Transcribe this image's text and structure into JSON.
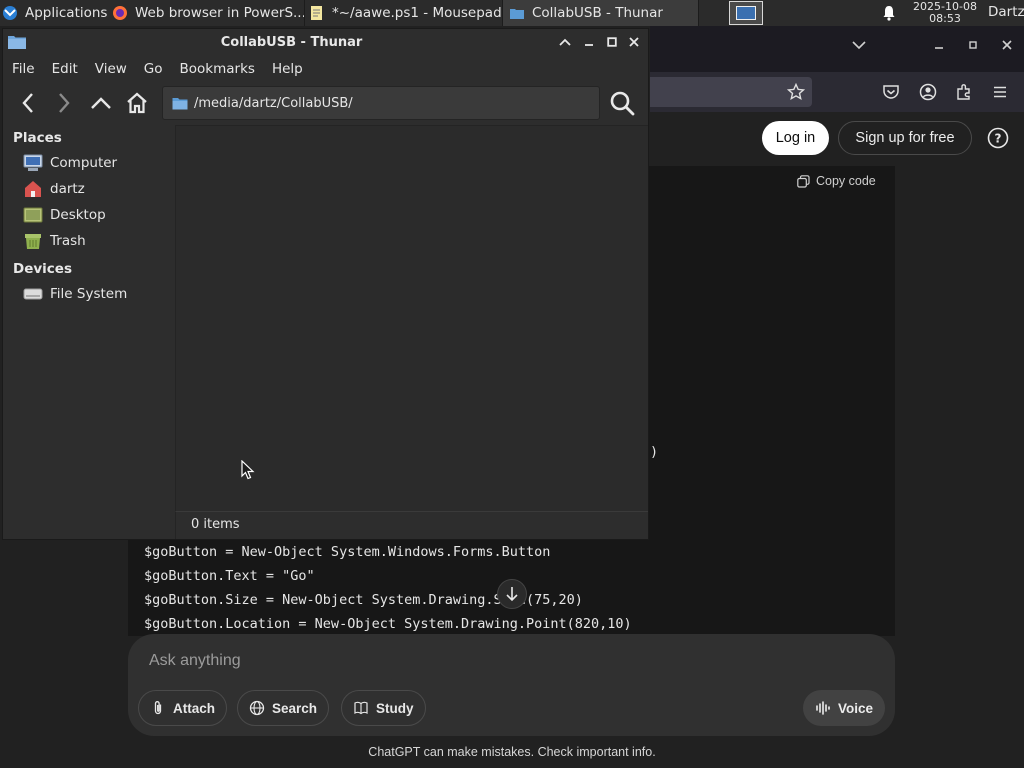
{
  "panel": {
    "applications_label": "Applications",
    "tasks": [
      {
        "label": "Web browser in PowerS..."
      },
      {
        "label": "*~/aawe.ps1 - Mousepad"
      },
      {
        "label": "CollabUSB - Thunar"
      }
    ],
    "clock_date": "2025-10-08",
    "clock_time": "08:53",
    "user": "Dartz"
  },
  "browser": {
    "login_label": "Log in",
    "signup_label": "Sign up for free",
    "copy_code_label": "Copy code",
    "code_fragment_paren": ")",
    "code_lines": [
      "$goButton = New-Object System.Windows.Forms.Button",
      "$goButton.Text = \"Go\"",
      "$goButton.Size = New-Object System.Drawing.Size(75,20)",
      "$goButton.Location = New-Object System.Drawing.Point(820,10)"
    ],
    "composer_placeholder": "Ask anything",
    "attach_label": "Attach",
    "search_label": "Search",
    "study_label": "Study",
    "voice_label": "Voice",
    "disclaimer": "ChatGPT can make mistakes. Check important info."
  },
  "thunar": {
    "title": "CollabUSB - Thunar",
    "menu": [
      "File",
      "Edit",
      "View",
      "Go",
      "Bookmarks",
      "Help"
    ],
    "location_path": "/media/dartz/CollabUSB/",
    "places_header": "Places",
    "places": [
      {
        "label": "Computer",
        "icon": "computer-icon"
      },
      {
        "label": "dartz",
        "icon": "home-folder-icon"
      },
      {
        "label": "Desktop",
        "icon": "desktop-icon"
      },
      {
        "label": "Trash",
        "icon": "trash-icon"
      }
    ],
    "devices_header": "Devices",
    "devices": [
      {
        "label": "File System",
        "icon": "drive-icon"
      }
    ],
    "status": "0 items"
  },
  "colors": {
    "panel_bg": "#2b2b2b",
    "window_bg": "#2d2d2d",
    "browser_bg": "#212121",
    "code_bg": "#171717",
    "accent_folder": "#5b9bd5"
  }
}
